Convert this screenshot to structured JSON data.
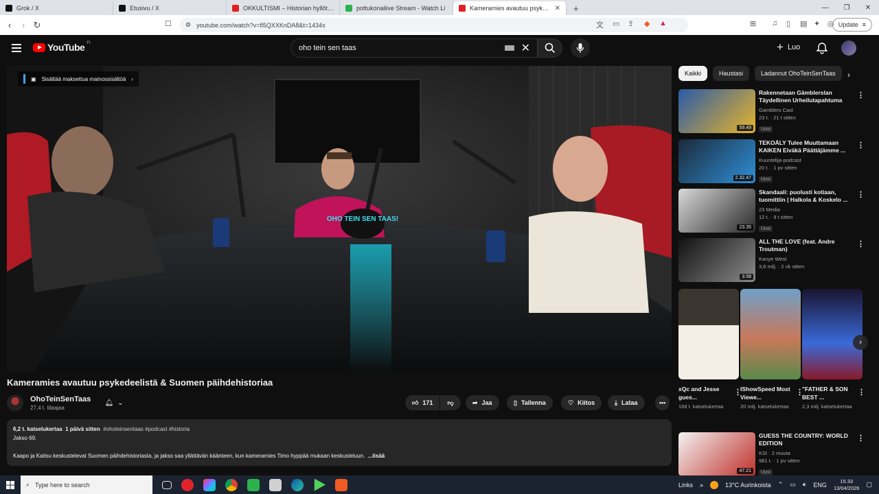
{
  "browser": {
    "tabs": [
      {
        "label": "Grok / X",
        "icon_color": "#111111"
      },
      {
        "label": "Etusivu / X",
        "icon_color": "#111111"
      },
      {
        "label": "OKKULTISMI – Historian hyllöty totuu",
        "icon_color": "#e02020"
      },
      {
        "label": "pottukonaliive Stream - Watch Li",
        "icon_color": "#2bb24c"
      },
      {
        "label": "Kameramies avautuu psykede",
        "icon_color": "#e02020"
      }
    ],
    "url": "youtube.com/watch?v=fl5QXXKnDA8&t=1434s",
    "update_label": "Update"
  },
  "yt": {
    "logo_text": "YouTube",
    "logo_region": "FI",
    "search_query": "oho tein sen taas",
    "create_label": "Luo"
  },
  "player": {
    "paid_notice": "Sisältää maksettua mainossisältöä",
    "mug_text": "OHO TEIN SEN TAAS!"
  },
  "video": {
    "title": "Kameramies avautuu psykedeelistä & Suomen päihdehistoriaa",
    "channel": "OhoTeinSenTaas",
    "subscribers": "27,4 t. tilaajaa",
    "likes": "171",
    "share": "Jaa",
    "save": "Tallenna",
    "thanks": "Kiitos",
    "download": "Lataa"
  },
  "description": {
    "views": "6,2 t. katselukertaa",
    "age": "1 päivä sitten",
    "tags": "#ohoteinsentaas #podcast #historia",
    "episode": "Jakso 69.",
    "text": "Kaapo ja Kaitsu keskustelevat Suomen päihdehistoriasta, ja jakso saa yllättävän käänteen, kun kameramies Timo hyppää mukaan keskusteluun.",
    "more": "...lisää"
  },
  "chips": [
    "Kaikki",
    "Haustasi",
    "Ladannut OhoTeinSenTaas"
  ],
  "recommendations": [
    {
      "title": "Rakennetaan Gämblerslan Täydellinen Urheilutapahtuma",
      "channel": "Gamblers Cast",
      "meta": "23 t. · 21 t sitten",
      "badge": "Uusi",
      "duration": "59.49",
      "colors": [
        "#2a5aa8",
        "#e8b52a"
      ]
    },
    {
      "title": "TEKOÄLY Tulee Muuttamaan KAIKEN Eiväkä Päättäjämme ...",
      "channel": "Kuuntelija-podcast",
      "meta": "20 t. · 1 pv sitten",
      "badge": "Uusi",
      "duration": "2.32.47",
      "colors": [
        "#1b2a3a",
        "#2f8fd8"
      ]
    },
    {
      "title": "Skandaali: puolusti kotiaan, tuomittiin | Halkola & Koskelo ...",
      "channel": "23 Media",
      "meta": "12 t. · 9 t sitten",
      "badge": "Uusi",
      "duration": "23.35",
      "colors": [
        "#d9d9d9",
        "#2a2a2a"
      ]
    },
    {
      "title": "ALL THE LOVE (feat. Andre Troutman)",
      "channel": "Kanye West",
      "meta": "3,8 milj. · 2 vk sitten",
      "badge": "",
      "duration": "3.58",
      "colors": [
        "#111111",
        "#8a8a8a"
      ]
    },
    {
      "title": "GUESS THE COUNTRY: WORLD EDITION",
      "channel": "KSI · 2 muuta",
      "meta": "981 t. · 1 pv sitten",
      "badge": "Uusi",
      "duration": "47.21",
      "colors": [
        "#f2f2f2",
        "#c0302a"
      ]
    }
  ],
  "shorts": [
    {
      "title": "xQc and Jesse gues...",
      "views": "168 t. katselukertaa",
      "colors": [
        "#f4efe6",
        "#c8841c"
      ]
    },
    {
      "title": "IShowSpeed Most Viewe...",
      "views": "20 milj. katselukertaa",
      "colors": [
        "#6fa0c8",
        "#c8785a"
      ]
    },
    {
      "title": "\"FATHER & SON BEST ...",
      "views": "2,3 milj. katselukertaa",
      "colors": [
        "#1a1430",
        "#3a6ad8"
      ]
    }
  ],
  "taskbar": {
    "search_placeholder": "Type here to search",
    "links": "Links",
    "weather": "13°C  Aurinkoista",
    "lang": "ENG",
    "time": "15.33",
    "date": "13/04/2026"
  }
}
